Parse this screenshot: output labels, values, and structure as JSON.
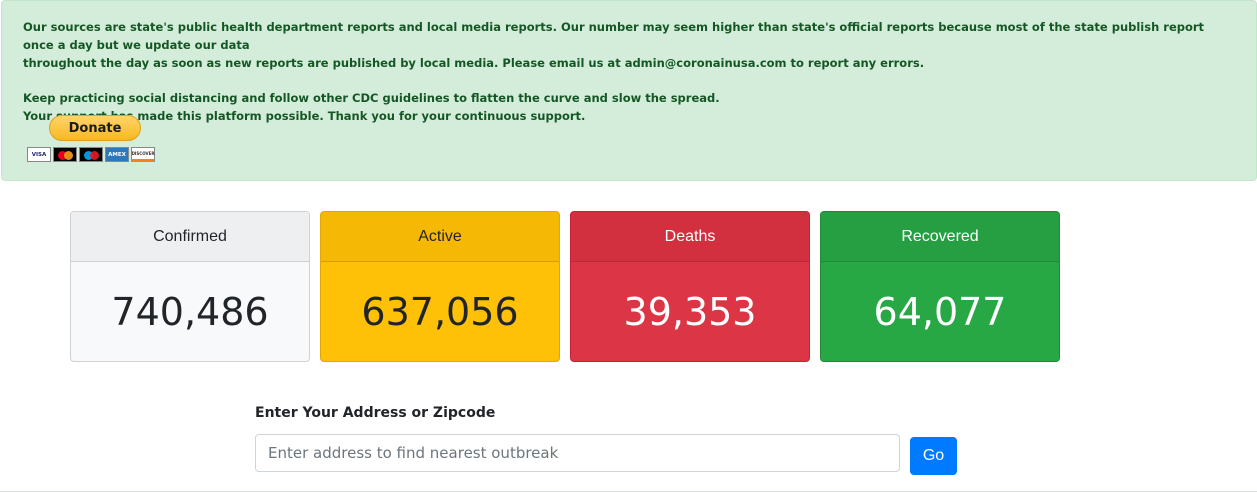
{
  "notice": {
    "line1": "Our sources are state's public health department reports and local media reports. Our number may seem higher than state's official reports because most of the state publish report once a day but we update our data",
    "line2": "throughout the day as soon as new reports are published by local media. Please email us at admin@coronainusa.com to report any errors.",
    "line3": "Keep practicing social distancing and follow other CDC guidelines to flatten the curve and slow the spread.",
    "line4": "Your support has made this platform possible. Thank you for your continuous support."
  },
  "donate": {
    "label": "Donate",
    "cards": {
      "visa": "VISA",
      "mastercard": "",
      "maestro": "",
      "amex": "AMEX",
      "discover": "DISCOVER"
    }
  },
  "stats": {
    "confirmed": {
      "label": "Confirmed",
      "value": "740,486"
    },
    "active": {
      "label": "Active",
      "value": "637,056"
    },
    "deaths": {
      "label": "Deaths",
      "value": "39,353"
    },
    "recovered": {
      "label": "Recovered",
      "value": "64,077"
    }
  },
  "colors": {
    "confirmed": "#f8f9fa",
    "active": "#ffc107",
    "deaths": "#dc3545",
    "recovered": "#28a745",
    "notice_bg": "#d4edda",
    "go_button": "#007bff"
  },
  "search": {
    "label": "Enter Your Address or Zipcode",
    "placeholder": "Enter address to find nearest outbreak",
    "value": "",
    "button": "Go"
  }
}
